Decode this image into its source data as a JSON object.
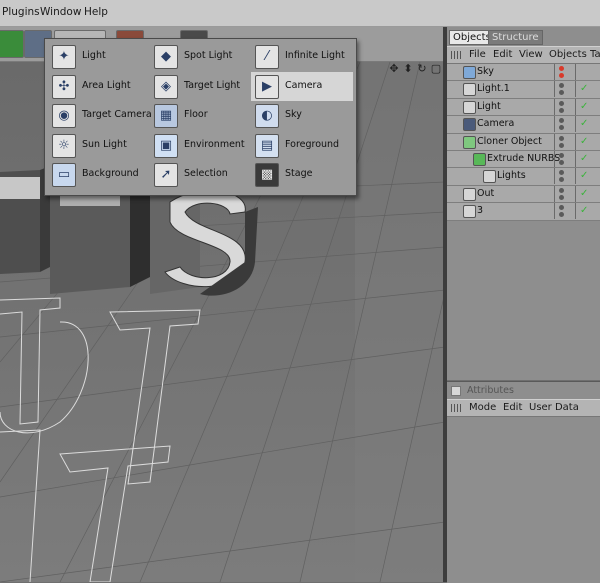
{
  "menubar": {
    "items": [
      "Plugins",
      "Window",
      "Help"
    ]
  },
  "viewport_nav": [
    "move-icon",
    "dolly-icon",
    "rotate-icon",
    "maximize-icon"
  ],
  "palette": {
    "columns": [
      [
        {
          "label": "Light",
          "icon": "light-icon"
        },
        {
          "label": "Area Light",
          "icon": "area-light-icon"
        },
        {
          "label": "Target Camera",
          "icon": "target-camera-icon"
        },
        {
          "label": "Sun Light",
          "icon": "sun-light-icon"
        },
        {
          "label": "Background",
          "icon": "background-icon"
        }
      ],
      [
        {
          "label": "Spot Light",
          "icon": "spot-light-icon"
        },
        {
          "label": "Target Light",
          "icon": "target-light-icon"
        },
        {
          "label": "Floor",
          "icon": "floor-icon"
        },
        {
          "label": "Environment",
          "icon": "environment-icon"
        },
        {
          "label": "Selection",
          "icon": "selection-icon"
        }
      ],
      [
        {
          "label": "Infinite Light",
          "icon": "infinite-light-icon"
        },
        {
          "label": "Camera",
          "icon": "camera-icon",
          "highlighted": true
        },
        {
          "label": "Sky",
          "icon": "sky-icon"
        },
        {
          "label": "Foreground",
          "icon": "foreground-icon"
        },
        {
          "label": "Stage",
          "icon": "stage-icon"
        }
      ]
    ]
  },
  "objects": {
    "tabs": [
      "Objects",
      "Structure"
    ],
    "menu": [
      "File",
      "Edit",
      "View",
      "Objects",
      "Ta"
    ],
    "items": [
      {
        "name": "Sky",
        "indent": 0
      },
      {
        "name": "Light.1",
        "indent": 0
      },
      {
        "name": "Light",
        "indent": 0
      },
      {
        "name": "Camera",
        "indent": 0
      },
      {
        "name": "Cloner Object",
        "indent": 0
      },
      {
        "name": "Extrude NURBS",
        "indent": 1
      },
      {
        "name": "Lights",
        "indent": 2
      },
      {
        "name": "Out",
        "indent": 0
      },
      {
        "name": "3",
        "indent": 0
      }
    ]
  },
  "attributes": {
    "title": "Attributes",
    "menu": [
      "Mode",
      "Edit",
      "User Data"
    ]
  },
  "colors": {
    "highlight": "#d6d6d6",
    "check": "#3bb33b",
    "sky_dot": "#d93a2a"
  }
}
